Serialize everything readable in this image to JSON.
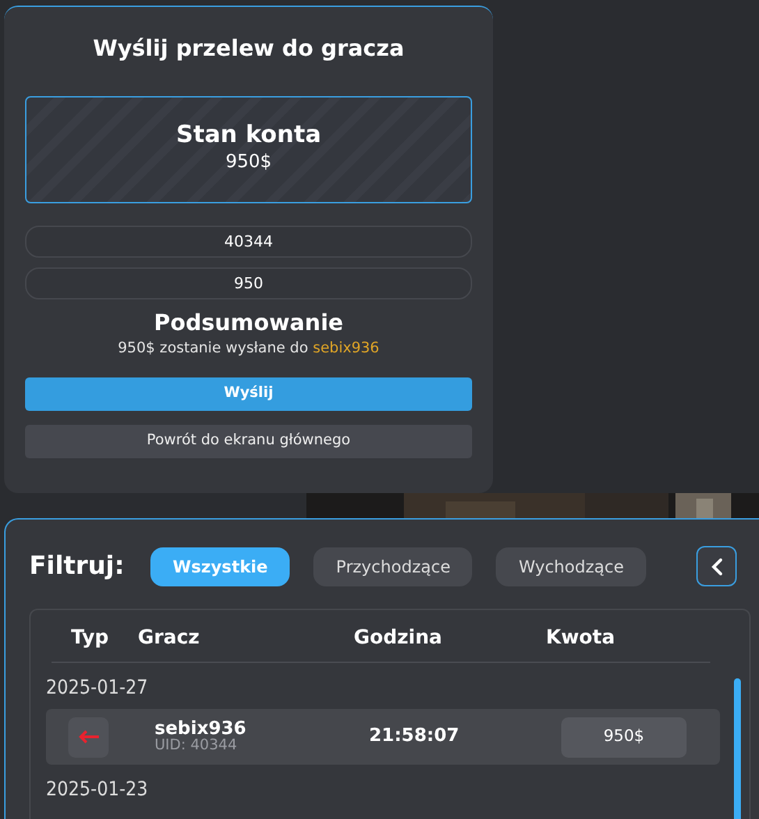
{
  "transfer_panel": {
    "title": "Wyślij przelew do gracza",
    "balance": {
      "label": "Stan konta",
      "value": "950$"
    },
    "fields": [
      {
        "value": "40344"
      },
      {
        "value": "950"
      }
    ],
    "summary": {
      "title": "Podsumowanie",
      "text": "950$ zostanie wysłane do",
      "recipient": "sebix936"
    },
    "buttons": [
      {
        "label": "Wyślij",
        "kind": "primary"
      },
      {
        "label": "Powrót do ekranu głównego",
        "kind": "secondary"
      }
    ]
  },
  "history_panel": {
    "filter_label": "Filtruj:",
    "filters": [
      {
        "label": "Wszystkie",
        "selected": true
      },
      {
        "label": "Przychodzące",
        "selected": false
      },
      {
        "label": "Wychodzące",
        "selected": false
      }
    ],
    "columns": [
      "Typ",
      "Gracz",
      "Godzina",
      "Kwota"
    ],
    "groups": [
      {
        "date": "2025-01-27",
        "transactions": [
          {
            "kind": "outgoing",
            "player": "sebix936",
            "uid": "UID: 40344",
            "time": "21:58:07",
            "amount": "950$"
          }
        ]
      },
      {
        "date": "2025-01-23"
      }
    ]
  }
}
